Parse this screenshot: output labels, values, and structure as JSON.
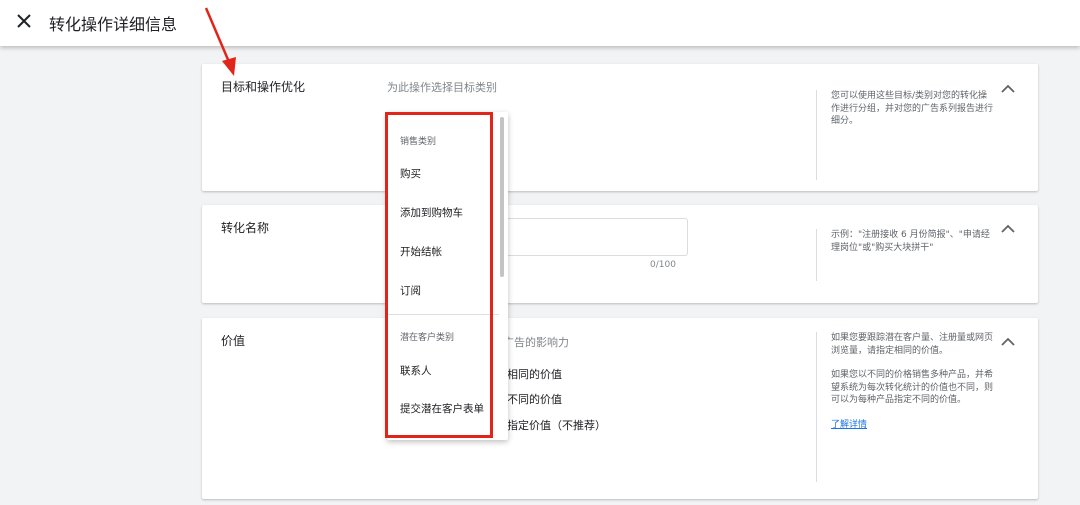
{
  "header": {
    "title": "转化操作详细信息",
    "close_icon": "close-icon"
  },
  "sections": {
    "goal": {
      "title": "目标和操作优化",
      "placeholder": "为此操作选择目标类别",
      "help": "您可以使用这些目标/类别对您的转化操作进行分组，并对您的广告系列报告进行细分。"
    },
    "name": {
      "title": "转化名称",
      "counter": "0/100",
      "help": "示例：\"注册接收 6 月份简报\"、\"申请经理岗位\"或\"购买大块拼干\""
    },
    "value": {
      "title": "价值",
      "subtitle_partial": "量广告的影响力",
      "options": [
        "相同的价值",
        "不同的价值",
        "指定价值（不推荐）"
      ],
      "help_p1": "如果您要跟踪潜在客户量、注册量或网页浏览量，请指定相同的价值。",
      "help_p2": "如果您以不同的价格销售多种产品，并希望系统为每次转化统计的价值也不同，则可以为每种产品指定不同的价值。",
      "learn_more": "了解详情"
    }
  },
  "dropdown": {
    "group1_header": "销售类别",
    "group1_items": [
      "购买",
      "添加到购物车",
      "开始结帐",
      "订阅"
    ],
    "group2_header": "潜在客户类别",
    "group2_items": [
      "联系人",
      "提交潜在客户表单"
    ]
  },
  "colors": {
    "highlight": "#e1251b",
    "link": "#1a73e8"
  }
}
